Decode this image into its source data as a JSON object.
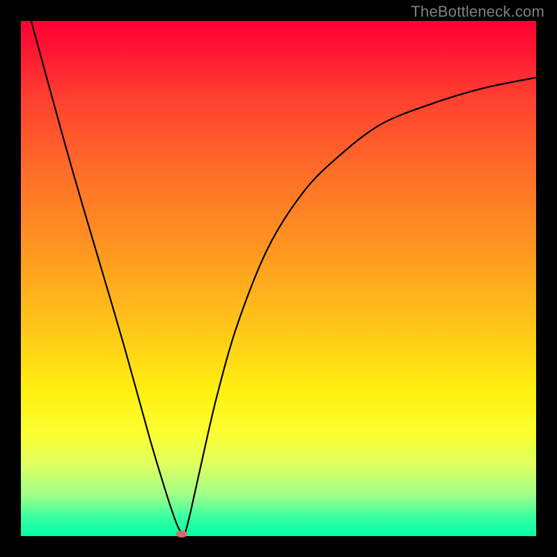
{
  "watermark": "TheBottleneck.com",
  "chart_data": {
    "type": "line",
    "title": "",
    "xlabel": "",
    "ylabel": "",
    "xlim": [
      0,
      100
    ],
    "ylim": [
      0,
      100
    ],
    "grid": false,
    "legend": false,
    "series": [
      {
        "name": "curve",
        "x": [
          2,
          5,
          10,
          15,
          20,
          25,
          28,
          30,
          31,
          31.5,
          32,
          33,
          35,
          38,
          42,
          48,
          55,
          62,
          70,
          80,
          90,
          100
        ],
        "y": [
          100,
          89,
          71,
          54,
          37,
          19,
          9,
          3,
          0.8,
          0.3,
          1,
          5,
          14,
          27,
          41,
          56,
          67,
          74,
          80,
          84,
          87,
          89
        ]
      }
    ],
    "marker": {
      "x": 31.2,
      "y": 0.4,
      "color": "#d96a6a"
    },
    "background_gradient": {
      "top": "#ff0033",
      "mid": "#ffe010",
      "bottom": "#00ffa8"
    }
  }
}
